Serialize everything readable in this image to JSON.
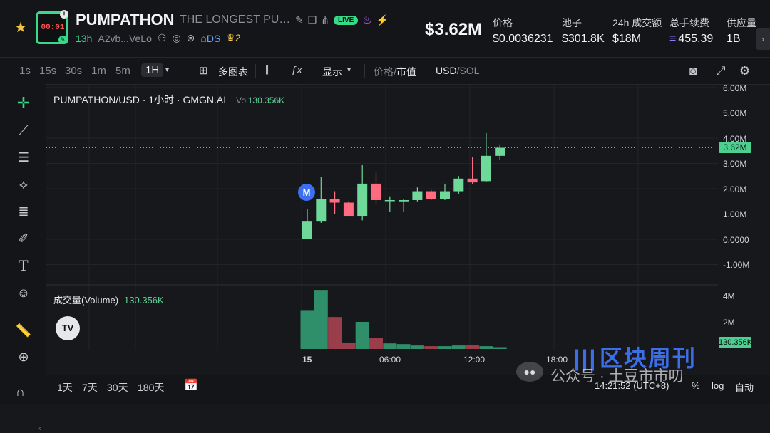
{
  "header": {
    "avatar_timer": "00:01",
    "symbol": "PUMPATHON",
    "name": "THE LONGEST PUMP...",
    "live": "LIVE",
    "age": "13h",
    "address": "A2vb...VeLo",
    "ds": "DS",
    "holders_badge": "2",
    "price": "$3.62M",
    "stats": [
      {
        "label": "价格",
        "value": "$0.0036231"
      },
      {
        "label": "池子",
        "value": "$301.8K"
      },
      {
        "label": "24h 成交额",
        "value": "$18M"
      },
      {
        "label": "总手续费",
        "value": "455.39"
      },
      {
        "label": "供应量",
        "value": "1B"
      }
    ]
  },
  "toolbar": {
    "timeframes": [
      "1s",
      "15s",
      "30s",
      "1m",
      "5m",
      "1H"
    ],
    "active_timeframe": "1H",
    "multi_chart": "多图表",
    "display": "显示",
    "price_label": "价格",
    "mcap_label": "市值",
    "usd": "USD",
    "sol": "SOL"
  },
  "chart": {
    "legend_title": "PUMPATHON/USD · 1小时 · GMGN.AI",
    "legend_vol_label": "Vol",
    "legend_vol_value": "130.356K",
    "volume_label": "成交量(Volume)",
    "volume_value": "130.356K",
    "marker": "M",
    "current_price_tag": "3.62M",
    "current_vol_tag": "130.356K",
    "y_ticks": [
      "6.00M",
      "5.00M",
      "4.00M",
      "3.00M",
      "2.00M",
      "1.00M",
      "0.0000",
      "-1.00M"
    ],
    "vol_ticks": [
      "4M",
      "2M"
    ],
    "x_ticks": [
      "15",
      "06:00",
      "12:00",
      "18:00"
    ]
  },
  "chart_data": {
    "type": "candlestick",
    "ylim": [
      -1.5,
      6.5
    ],
    "y_unit": "M USD",
    "candles": [
      {
        "o": 0.0,
        "h": 1.2,
        "l": 0.0,
        "c": 0.7
      },
      {
        "o": 0.7,
        "h": 2.45,
        "l": 0.65,
        "c": 1.6
      },
      {
        "o": 1.6,
        "h": 1.9,
        "l": 1.0,
        "c": 1.45
      },
      {
        "o": 1.45,
        "h": 1.5,
        "l": 0.9,
        "c": 0.9
      },
      {
        "o": 0.9,
        "h": 2.95,
        "l": 0.75,
        "c": 2.2
      },
      {
        "o": 2.2,
        "h": 2.65,
        "l": 1.4,
        "c": 1.55
      },
      {
        "o": 1.55,
        "h": 1.7,
        "l": 1.1,
        "c": 1.55
      },
      {
        "o": 1.5,
        "h": 1.6,
        "l": 1.1,
        "c": 1.55
      },
      {
        "o": 1.55,
        "h": 2.05,
        "l": 1.5,
        "c": 1.9
      },
      {
        "o": 1.9,
        "h": 1.95,
        "l": 1.55,
        "c": 1.6
      },
      {
        "o": 1.6,
        "h": 2.2,
        "l": 1.55,
        "c": 1.9
      },
      {
        "o": 1.9,
        "h": 2.5,
        "l": 1.8,
        "c": 2.4
      },
      {
        "o": 2.4,
        "h": 3.25,
        "l": 2.2,
        "c": 2.25
      },
      {
        "o": 2.3,
        "h": 4.2,
        "l": 2.25,
        "c": 3.3
      },
      {
        "o": 3.3,
        "h": 3.75,
        "l": 3.15,
        "c": 3.62
      }
    ],
    "volume": [
      2.8,
      4.25,
      2.3,
      0.45,
      1.95,
      0.8,
      0.4,
      0.35,
      0.25,
      0.2,
      0.2,
      0.25,
      0.3,
      0.2,
      0.13
    ],
    "vol_ylim": [
      0,
      4.5
    ],
    "vol_unit": "M"
  },
  "left_tools": [
    "crosshair",
    "trend-line",
    "horizontal-lines",
    "pattern",
    "fib",
    "brush",
    "text",
    "emoji",
    "ruler",
    "zoom-in",
    "magnet"
  ],
  "bottom": {
    "ranges": [
      "1天",
      "7天",
      "30天",
      "180天"
    ],
    "clock": "14:21:52 (UTC+8)",
    "percent": "%",
    "log": "log",
    "auto": "自动"
  },
  "watermark": {
    "brand": "区块周刊",
    "account": "公众号 · 土豆市市叨"
  },
  "colors": {
    "up": "#6fd99a",
    "down": "#ff6b81",
    "accent": "#39d98a"
  }
}
